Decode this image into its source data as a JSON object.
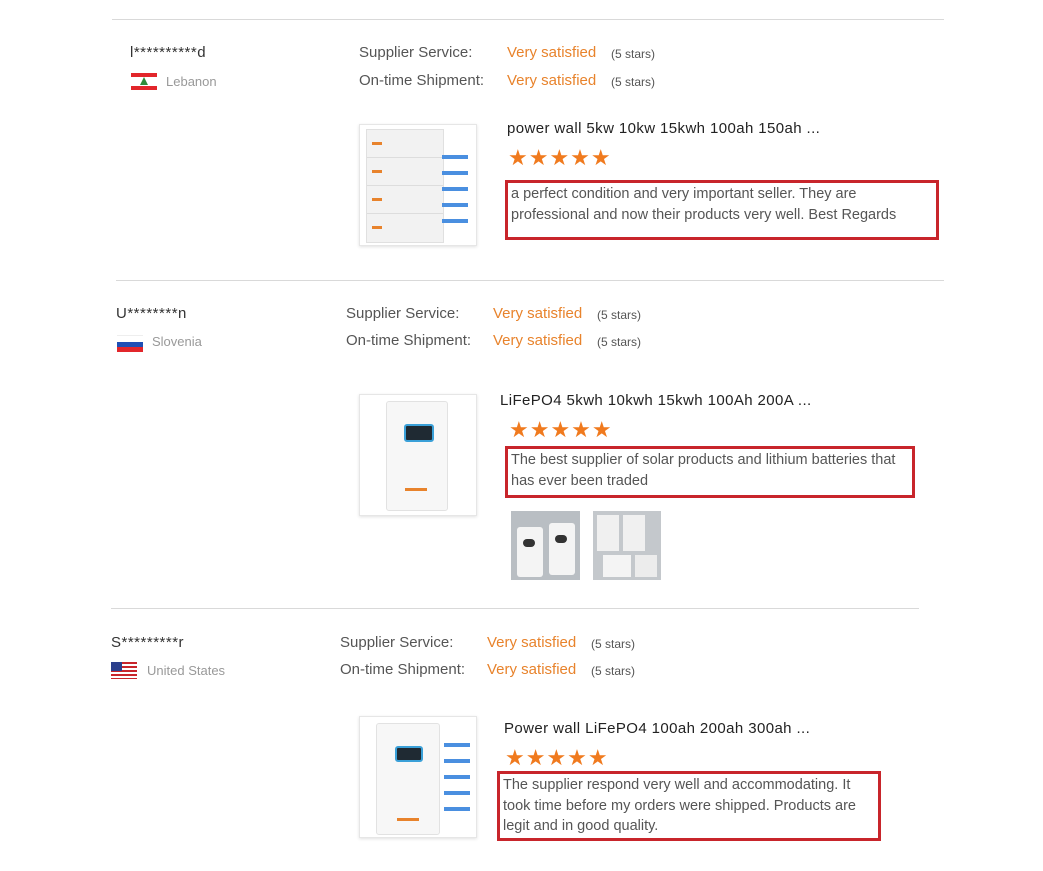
{
  "labels": {
    "supplier_service": "Supplier Service:",
    "on_time_shipment": "On-time Shipment:"
  },
  "reviews": [
    {
      "name": "l**********d",
      "country": "Lebanon",
      "supplier_service": "Very satisfied",
      "supplier_service_stars": "(5 stars)",
      "on_time_shipment": "Very satisfied",
      "on_time_shipment_stars": "(5 stars)",
      "product_title": "power wall 5kw 10kw 15kwh 100ah 150ah ...",
      "rating": "★★★★★",
      "comment": "a perfect condition and very important seller. They are professional and now their products very well. Best Regards"
    },
    {
      "name": "U********n",
      "country": "Slovenia",
      "supplier_service": "Very satisfied",
      "supplier_service_stars": "(5 stars)",
      "on_time_shipment": "Very satisfied",
      "on_time_shipment_stars": "(5 stars)",
      "product_title": "LiFePO4 5kwh 10kwh 15kwh 100Ah 200A ...",
      "rating": "★★★★★",
      "comment": "The best supplier of solar products and lithium batteries that has ever been traded"
    },
    {
      "name": "S*********r",
      "country": "United States",
      "supplier_service": "Very satisfied",
      "supplier_service_stars": "(5 stars)",
      "on_time_shipment": "Very satisfied",
      "on_time_shipment_stars": "(5 stars)",
      "product_title": "Power wall LiFePO4 100ah 200ah 300ah ...",
      "rating": "★★★★★",
      "comment": "The supplier respond very well and accommodating. It took time before my orders were shipped. Products are legit and in good quality."
    }
  ],
  "colors": {
    "accent": "#e8832c",
    "star": "#f07a1e",
    "highlight_box": "#c8252b"
  }
}
